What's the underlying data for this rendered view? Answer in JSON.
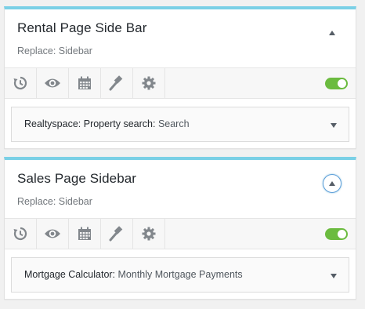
{
  "colors": {
    "accent_border": "#7ad0e6",
    "toggle_on": "#6bbb3f",
    "icon": "#82878c",
    "focus_ring": "#5b9dd9"
  },
  "panels": [
    {
      "title": "Rental Page Side Bar",
      "subtitle": "Replace: Sidebar",
      "collapse_icon": "triangle-up-icon",
      "toolbar_icons": [
        "history-icon",
        "eye-icon",
        "calendar-icon",
        "gavel-icon",
        "gear-icon"
      ],
      "toggle_on": true,
      "widget": {
        "name": "Realtyspace: Property search:",
        "title": "Search",
        "expand_icon": "triangle-down-icon"
      }
    },
    {
      "title": "Sales Page Sidebar",
      "subtitle": "Replace: Sidebar",
      "collapse_icon": "triangle-up-icon",
      "toolbar_icons": [
        "history-icon",
        "eye-icon",
        "calendar-icon",
        "gavel-icon",
        "gear-icon"
      ],
      "toggle_on": true,
      "widget": {
        "name": "Mortgage Calculator:",
        "title": "Monthly Mortgage Payments",
        "expand_icon": "triangle-down-icon"
      }
    }
  ]
}
